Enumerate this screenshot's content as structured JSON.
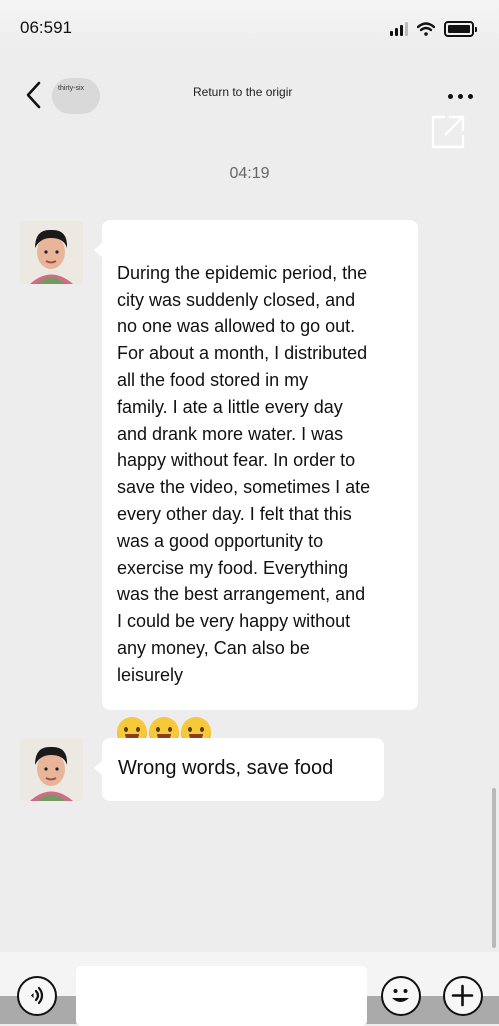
{
  "status_bar": {
    "time": "06:591"
  },
  "nav": {
    "contact_name": "thirty-six",
    "title": "Return to the origir"
  },
  "chat": {
    "timestamp": "04:19",
    "messages": [
      {
        "text": "During the epidemic period, the\ncity was suddenly closed, and\nno one was allowed to go out.\nFor about a month, I distributed\n all the food stored in my\nfamily. I ate a little every day\nand drank more water. I was\nhappy without fear. In order to\nsave the video, sometimes I ate\nevery other day. I felt that this\nwas a good opportunity to\nexercise my food. Everything\nwas the best arrangement, and\nI could be very happy without\nany money, Can also be\nleisurely",
        "emojis": [
          "hug-emoji",
          "hug-emoji",
          "hug-emoji"
        ]
      },
      {
        "text": "Wrong words, save food"
      }
    ]
  },
  "icons": {
    "back": "chevron-left-icon",
    "more": "more-dots-icon",
    "share": "share-external-icon",
    "voice": "voice-icon",
    "emoji": "emoji-icon",
    "plus": "plus-icon"
  }
}
